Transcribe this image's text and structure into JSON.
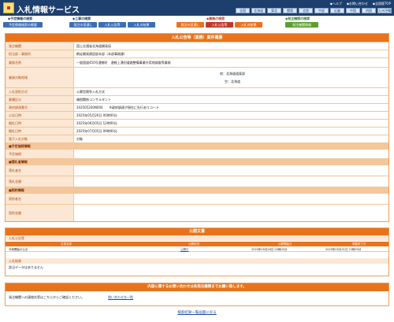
{
  "header": {
    "title": "入札情報サービス",
    "links": [
      "◆ヘルプ",
      "◆お問い合わせ",
      "◆全国版TOP"
    ],
    "regions": [
      "全国",
      "北海道",
      "東北",
      "関東",
      "北陸",
      "中部",
      "近畿",
      "中国",
      "四国",
      "九州沖縄"
    ]
  },
  "groups": [
    {
      "label": "◆予定情報の検索",
      "color": "#1d3f6e",
      "tabs": [
        {
          "label": "予定情報検索の概要",
          "color": "#3a6fb6"
        }
      ]
    },
    {
      "label": "◆工事の検索",
      "color": "#1d3f6e",
      "tabs": [
        {
          "label": "発注の見通し",
          "color": "#3a6fb6"
        },
        {
          "label": "入札公告等",
          "color": "#3a6fb6"
        },
        {
          "label": "入札の結果",
          "color": "#3a6fb6"
        }
      ]
    },
    {
      "label": "◆業務の検索",
      "color": "#c0392b",
      "tabs": [
        {
          "label": "発注の見通し",
          "color": "#e8731c"
        },
        {
          "label": "入札公告等",
          "color": "#c0392b",
          "active": true
        },
        {
          "label": "入札の結果",
          "color": "#e8731c"
        }
      ]
    },
    {
      "label": "◆発注機関の検索",
      "color": "#2e7d32",
      "tabs": [
        {
          "label": "発注機関情報",
          "color": "#5aa02c"
        }
      ]
    }
  ],
  "detail": {
    "title": "入札公告等（業務）案件概要",
    "rows": [
      {
        "label": "発注機関",
        "value": "国土交通省北海道開発局"
      },
      {
        "label": "担当部・事務所",
        "value": "網走開発建設部本部（本部事務課）"
      },
      {
        "label": "業務名称",
        "value": "一般国道450号遠軽町　遠軽上湧別道路整備事業外用地調査等業務"
      },
      {
        "label": "業務対象地域",
        "values": [
          "他：北海道道東部",
          "空：北海道"
        ]
      },
      {
        "label": "入札契約方式",
        "value": "公募型競争入札方式"
      },
      {
        "label": "業種区分",
        "value": "補償関係コンサルタント"
      },
      {
        "label": "政府調達番号",
        "value": "202505200N000　　※政府調達が現在に先行ありコード"
      },
      {
        "label": "公告日時",
        "value": "2025年05月26日 00時00分"
      },
      {
        "label": "開札日時",
        "value": "2025年06月05日 12時00分"
      },
      {
        "label": "開札日時",
        "value": "2025年07月05日 09時00分"
      },
      {
        "label": "電子入札対象",
        "value": "対象"
      },
      {
        "label": "■予定価格情報",
        "category": true
      },
      {
        "label": "予定価格",
        "value": ""
      },
      {
        "label": "■落札者情報",
        "category": true
      },
      {
        "label": "落札者名",
        "value": ""
      },
      {
        "label": "落札金額",
        "value": ""
      },
      {
        "label": "■契約情報",
        "category": true
      },
      {
        "label": "契約者名",
        "value": ""
      },
      {
        "label": "契約金額",
        "value": ""
      }
    ]
  },
  "documents": {
    "title": "公開文書",
    "notice_label": "入札公告等",
    "columns": [
      "文書名称",
      "公開状況",
      "公開開始日",
      "掲載終了日"
    ],
    "rows": [
      {
        "name": "令和開始の公示",
        "status": "公開中",
        "start": "2025年05月26日 00時00分",
        "end": "2025年05月31日 23時59分"
      }
    ],
    "results_label": "入札結果",
    "results_empty": "該当データはありません"
  },
  "contact": {
    "title": "内容に関するお問い合わせは各発注機関までお願い致します。",
    "text": "発注機関への連絡先等はこちらからご確認ください。",
    "link": "問い合わせ先一覧"
  },
  "back_link": "検索結果一覧画面に戻る"
}
